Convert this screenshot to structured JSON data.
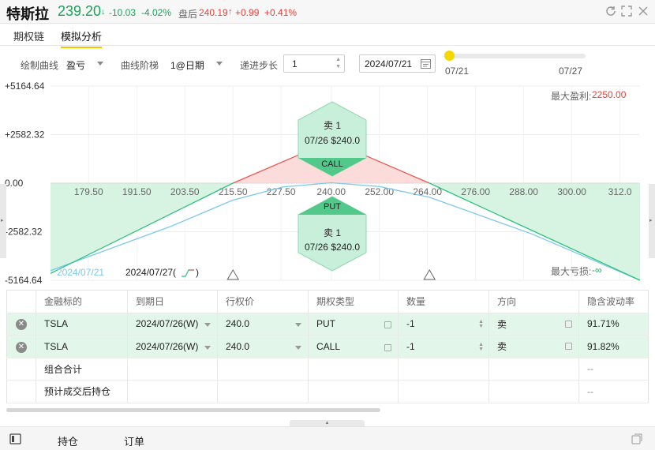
{
  "header": {
    "title": "特斯拉",
    "price": "239.20",
    "price_arrow": "↓",
    "change": "-10.03",
    "change_pct": "-4.02%",
    "after_label": "盘后",
    "after_price": "240.19",
    "after_arrow": "↑",
    "after_change": "+0.99",
    "after_change_pct": "+0.41%",
    "colors": {
      "down": "#1aa35a",
      "up": "#e8413b"
    }
  },
  "tabs": [
    {
      "label": "期权链"
    },
    {
      "label": "模拟分析",
      "active": true
    }
  ],
  "controls": {
    "curve_label": "绘制曲线",
    "curve_value": "盈亏",
    "ladder_label": "曲线阶梯",
    "ladder_value": "1@日期",
    "step_label": "递进步长",
    "step_value": "1",
    "date_value": "2024/07/21",
    "slider_start": "07/21",
    "slider_end": "07/27",
    "slider_level": 0.0
  },
  "chart_data": {
    "type": "line",
    "y_ticks": [
      "+5164.64",
      "+2582.32",
      "0.00",
      "-2582.32",
      "-5164.64"
    ],
    "ylim": [
      -5164.64,
      5164.64
    ],
    "x_ticks": [
      "179.50",
      "191.50",
      "203.50",
      "215.50",
      "227.50",
      "240.00",
      "252.00",
      "264.00",
      "276.00",
      "288.00",
      "300.00",
      "312.0"
    ],
    "xlim": [
      170,
      317
    ],
    "series": [
      {
        "name": "2024/07/27",
        "color_pos": "#e85a4f",
        "color_neg": "#2ec27e",
        "points": [
          [
            170,
            -4800
          ],
          [
            215.5,
            0
          ],
          [
            240,
            2250
          ],
          [
            264.5,
            0
          ],
          [
            317,
            -5164.64
          ]
        ]
      },
      {
        "name": "2024/07/21",
        "color": "#7cc8ea",
        "points": [
          [
            170,
            -4650
          ],
          [
            200,
            -2300
          ],
          [
            215.5,
            -900
          ],
          [
            228,
            -200
          ],
          [
            240,
            20
          ],
          [
            252,
            -180
          ],
          [
            264.5,
            -750
          ],
          [
            290,
            -2700
          ],
          [
            317,
            -5164.64
          ]
        ]
      }
    ],
    "max_profit_label": "最大盈利:",
    "max_profit_value": "2250.00",
    "max_loss_label": "最大亏损:",
    "max_loss_value": "-∞",
    "breakevens": [
      215.5,
      264.5
    ],
    "legend": [
      "2024/07/21",
      "2024/07/27(",
      ")"
    ],
    "annotations": {
      "call_side": "卖 1",
      "call_detail": "07/26 $240.0",
      "call_tag": "CALL",
      "put_side": "卖 1",
      "put_detail": "07/26 $240.0",
      "put_tag": "PUT"
    }
  },
  "table": {
    "headers": [
      "金融标的",
      "到期日",
      "行权价",
      "期权类型",
      "数量",
      "方向",
      "隐含波动率"
    ],
    "rows": [
      {
        "symbol": "TSLA",
        "expiry": "2024/07/26(W)",
        "strike": "240.0",
        "type": "PUT",
        "qty": "-1",
        "direction": "卖",
        "iv": "91.71%"
      },
      {
        "symbol": "TSLA",
        "expiry": "2024/07/26(W)",
        "strike": "240.0",
        "type": "CALL",
        "qty": "-1",
        "direction": "卖",
        "iv": "91.82%"
      }
    ],
    "summary_rows": [
      {
        "label": "组合合计",
        "iv": "--"
      },
      {
        "label": "预计成交后持仓",
        "iv": "--"
      }
    ]
  },
  "footer": {
    "positions": "持仓",
    "orders": "订单"
  }
}
